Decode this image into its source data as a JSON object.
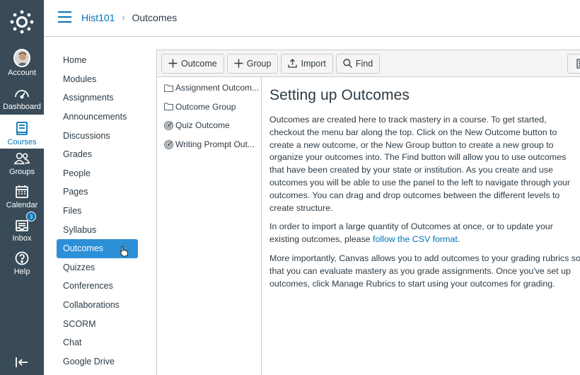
{
  "global_nav": {
    "items": [
      {
        "label": "Account",
        "icon": "avatar"
      },
      {
        "label": "Dashboard",
        "icon": "dashboard-icon"
      },
      {
        "label": "Courses",
        "icon": "courses-icon"
      },
      {
        "label": "Groups",
        "icon": "groups-icon"
      },
      {
        "label": "Calendar",
        "icon": "calendar-icon"
      },
      {
        "label": "Inbox",
        "icon": "inbox-icon",
        "badge": "3"
      },
      {
        "label": "Help",
        "icon": "help-icon"
      }
    ],
    "active": "Courses",
    "colors": {
      "background": "#394b58",
      "accent": "#0374b5"
    }
  },
  "header": {
    "course": "Hist101",
    "separator": "›",
    "page": "Outcomes"
  },
  "course_nav": {
    "items": [
      "Home",
      "Modules",
      "Assignments",
      "Announcements",
      "Discussions",
      "Grades",
      "People",
      "Pages",
      "Files",
      "Syllabus",
      "Outcomes",
      "Quizzes",
      "Conferences",
      "Collaborations",
      "SCORM",
      "Chat",
      "Google Drive"
    ],
    "active": "Outcomes"
  },
  "toolbar": {
    "outcome": "Outcome",
    "group": "Group",
    "import": "Import",
    "find": "Find"
  },
  "tree": {
    "items": [
      {
        "label": "Assignment Outcom...",
        "icon": "folder-icon"
      },
      {
        "label": "Outcome Group",
        "icon": "folder-icon"
      },
      {
        "label": "Quiz Outcome",
        "icon": "outcome-icon"
      },
      {
        "label": "Writing Prompt Out...",
        "icon": "outcome-icon"
      }
    ]
  },
  "panel": {
    "title": "Setting up Outcomes",
    "p1": "Outcomes are created here to track mastery in a course. To get started, checkout the menu bar along the top. Click on the New Outcome button to create a new outcome, or the New Group button to create a new group to organize your outcomes into. The Find button will allow you to use outcomes that have been created by your state or institution. As you create and use outcomes you will be able to use the panel to the left to navigate through your outcomes. You can drag and drop outcomes between the different levels to create structure.",
    "p2_before": "In order to import a large quantity of Outcomes at once, or to update your existing outcomes, please ",
    "p2_link": "follow the CSV format",
    "p2_after": ".",
    "p3": "More importantly, Canvas allows you to add outcomes to your grading rubrics so that you can evaluate mastery as you grade assignments. Once you've set up outcomes, click Manage Rubrics to start using your outcomes for grading."
  }
}
